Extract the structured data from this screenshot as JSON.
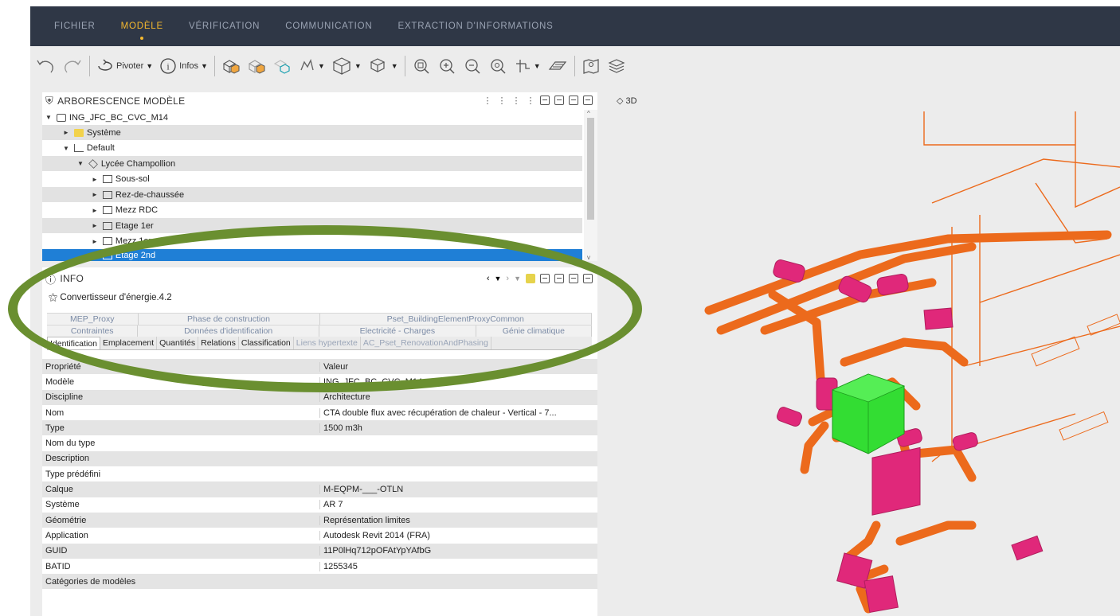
{
  "menubar": {
    "items": [
      "FICHIER",
      "MODÈLE",
      "VÉRIFICATION",
      "COMMUNICATION",
      "EXTRACTION D'INFORMATIONS"
    ],
    "active_index": 1,
    "active_color": "#f5b82e",
    "bg_color": "#2f3746"
  },
  "toolbar": {
    "undo_icon": "undo-icon",
    "redo_icon": "redo-icon",
    "rotate_label": "Pivoter",
    "info_label": "Infos"
  },
  "tree": {
    "title": "ARBORESCENCE MODÈLE",
    "items": [
      {
        "label": "ING_JFC_BC_CVC_M14",
        "level": 0,
        "icon": "model-icon",
        "expanded": true
      },
      {
        "label": "Système",
        "level": 1,
        "icon": "folder-icon",
        "expanded": false
      },
      {
        "label": "Default",
        "level": 1,
        "icon": "site-icon",
        "expanded": true
      },
      {
        "label": "Lycée Champollion",
        "level": 2,
        "icon": "building-icon",
        "expanded": true
      },
      {
        "label": "Sous-sol",
        "level": 3,
        "icon": "storey-icon",
        "expanded": false
      },
      {
        "label": "Rez-de-chaussée",
        "level": 3,
        "icon": "storey-icon",
        "expanded": false
      },
      {
        "label": "Mezz RDC",
        "level": 3,
        "icon": "storey-icon",
        "expanded": false
      },
      {
        "label": "Etage 1er",
        "level": 3,
        "icon": "storey-icon",
        "expanded": false
      },
      {
        "label": "Mezz 1er",
        "level": 3,
        "icon": "storey-icon",
        "expanded": false
      },
      {
        "label": "Etage 2nd",
        "level": 3,
        "icon": "storey-icon",
        "expanded": false
      }
    ],
    "selected_index": 9,
    "selected_color": "#1f7fd6"
  },
  "view": {
    "label": "3D"
  },
  "info": {
    "title": "INFO",
    "entity": "Convertisseur d'énergie.4.2",
    "tabs_row1": [
      "MEP_Proxy",
      "Phase de construction",
      "Pset_BuildingElementProxyCommon"
    ],
    "tabs_row2": [
      "Contraintes",
      "Données d'identification",
      "Electricité - Charges",
      "Génie climatique"
    ],
    "tabs_row3": [
      "Identification",
      "Emplacement",
      "Quantités",
      "Relations",
      "Classification",
      "Liens hypertexte",
      "AC_Pset_RenovationAndPhasing"
    ],
    "active_tab": "Identification",
    "columns": [
      "Propriété",
      "Valeur"
    ],
    "rows": [
      [
        "Modèle",
        "ING_JFC_BC_CVC_M14"
      ],
      [
        "Discipline",
        "Architecture"
      ],
      [
        "Nom",
        "CTA double flux avec récupération de chaleur - Vertical - 7..."
      ],
      [
        "Type",
        "1500 m3h"
      ],
      [
        "Nom du type",
        ""
      ],
      [
        "Description",
        ""
      ],
      [
        "Type prédéfini",
        ""
      ],
      [
        "Calque",
        "M-EQPM-___-OTLN"
      ],
      [
        "Système",
        "AR 7"
      ],
      [
        "Géométrie",
        "Représentation limites"
      ],
      [
        "Application",
        "Autodesk Revit 2014 (FRA)"
      ],
      [
        "GUID",
        "11P0lHq712pOFAtYpYAfbG"
      ],
      [
        "BATID",
        "1255345"
      ],
      [
        "Catégories de modèles",
        ""
      ]
    ]
  },
  "colors": {
    "duct": "#ec6a1c",
    "equipment": "#e0287a",
    "selected_equipment": "#33dd33",
    "annotation_circle": "#6a8f30"
  }
}
